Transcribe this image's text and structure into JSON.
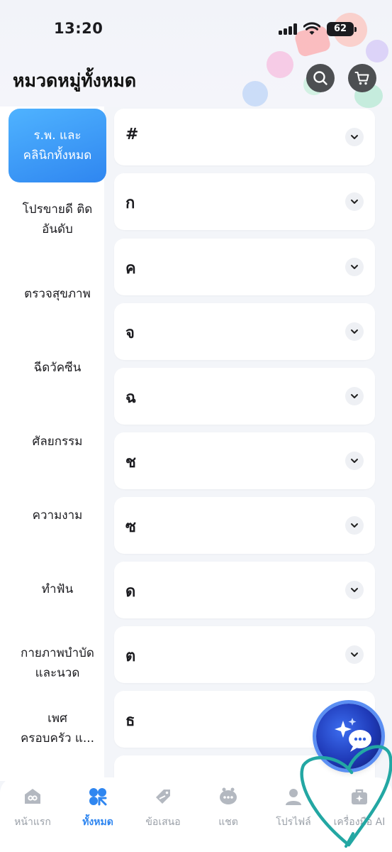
{
  "status_bar": {
    "time": "13:20",
    "battery": "62"
  },
  "header": {
    "title": "หมวดหมู่ทั้งหมด",
    "search_icon": "search-icon",
    "cart_icon": "cart-icon"
  },
  "sidebar": {
    "items": [
      {
        "label": "ร.พ. และ\nคลินิกทั้งหมด",
        "active": true
      },
      {
        "label": "โปรขายดี ติด\nอันดับ"
      },
      {
        "label": "ตรวจสุขภาพ"
      },
      {
        "label": "ฉีดวัคซีน"
      },
      {
        "label": "ศัลยกรรม"
      },
      {
        "label": "ความงาม"
      },
      {
        "label": "ทำฟัน"
      },
      {
        "label": "กายภาพบำบัด\nและนวด"
      },
      {
        "label": "เพศ\nครอบครัว แ..."
      }
    ]
  },
  "letters": [
    "#",
    "ก",
    "ค",
    "จ",
    "ฉ",
    "ช",
    "ซ",
    "ด",
    "ต",
    "ธ"
  ],
  "tab_bar": {
    "tabs": [
      {
        "label": "หน้าแรก",
        "icon": "home-icon"
      },
      {
        "label": "ทั้งหมด",
        "icon": "categories-icon",
        "active": true
      },
      {
        "label": "ข้อเสนอ",
        "icon": "tag-icon"
      },
      {
        "label": "แชต",
        "icon": "chat-icon"
      },
      {
        "label": "โปรไฟล์",
        "icon": "profile-icon"
      },
      {
        "label": "เครื่องมือ AI",
        "icon": "ai-toolbox-icon"
      }
    ]
  },
  "colors": {
    "accent": "#2f86f0",
    "annotation": "#23a7a3"
  }
}
